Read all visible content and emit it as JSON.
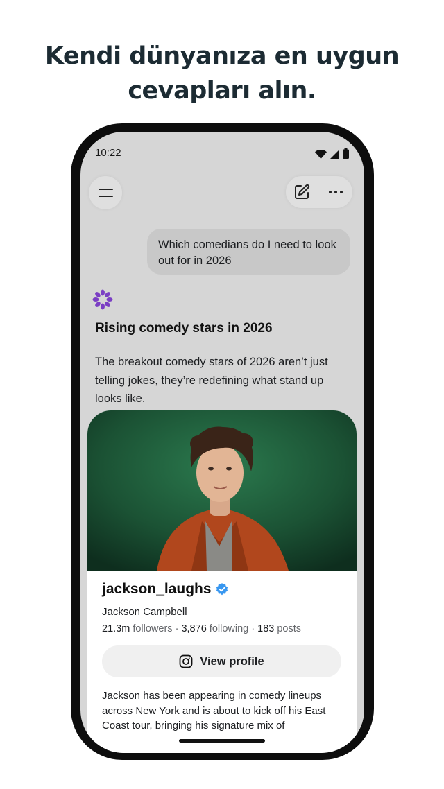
{
  "headline": {
    "line1": "Kendi dünyanıza en uygun",
    "line2": "cevapları alın."
  },
  "status_bar": {
    "time": "10:22",
    "icons": [
      "wifi-icon",
      "signal-icon",
      "battery-icon"
    ]
  },
  "top_bar": {
    "menu_icon": "hamburger-menu-icon",
    "edit_icon": "edit-icon",
    "more_icon": "more-horizontal-icon"
  },
  "chat": {
    "user_message": "Which comedians do I need to look out for in 2026",
    "ai_logo_icon": "meta-ai-flower-icon",
    "answer_title": "Rising comedy stars in 2026",
    "answer_text": "The breakout comedy stars of 2026 aren’t just telling jokes, they’re redefining what stand up looks like."
  },
  "profile_card": {
    "handle": "jackson_laughs",
    "verified_icon": "verified-badge-icon",
    "name": "Jackson Campbell",
    "followers_value": "21.3m",
    "followers_label": "followers",
    "following_value": "3,876",
    "following_label": "following",
    "posts_value": "183",
    "posts_label": "posts",
    "separator": "·",
    "view_profile_label": "View profile",
    "view_profile_icon": "instagram-icon",
    "bio": "Jackson has been appearing in comedy lineups across New York and is about to kick off his East Coast tour, bringing his signature mix of"
  },
  "colors": {
    "screen_bg": "#d6d6d6",
    "bubble_bg": "#c8c8c8",
    "verified_blue": "#3897f0",
    "logo_purple": "#7b3fc4",
    "photo_bg": "#1f5a3a"
  }
}
